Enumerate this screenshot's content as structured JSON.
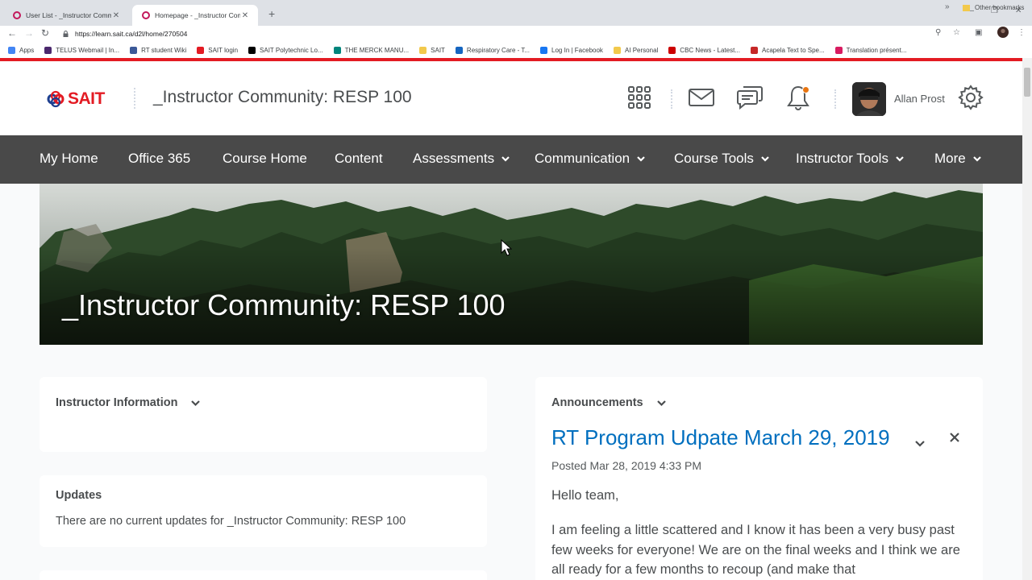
{
  "browser": {
    "tabs": [
      {
        "title": "User List - _Instructor Community",
        "active": false
      },
      {
        "title": "Homepage - _Instructor Community",
        "active": true
      }
    ],
    "url": "https://learn.sait.ca/d2l/home/270504",
    "bookmarks": [
      {
        "label": "Apps",
        "color": "#4285f4"
      },
      {
        "label": "TELUS Webmail | In...",
        "color": "#4b286d"
      },
      {
        "label": "RT student Wiki",
        "color": "#3b5998"
      },
      {
        "label": "SAIT login",
        "color": "#e31b23"
      },
      {
        "label": "SAIT Polytechnic Lo...",
        "color": "#000000"
      },
      {
        "label": "THE MERCK MANU...",
        "color": "#00857c"
      },
      {
        "label": "SAIT",
        "color": "#f2c94c"
      },
      {
        "label": "Respiratory Care - T...",
        "color": "#1565c0"
      },
      {
        "label": "Log In | Facebook",
        "color": "#1877f2"
      },
      {
        "label": "AI Personal",
        "color": "#f2c94c"
      },
      {
        "label": "CBC News - Latest...",
        "color": "#cc0000"
      },
      {
        "label": "Acapela Text to Spe...",
        "color": "#c62828"
      },
      {
        "label": "Translation présent...",
        "color": "#d81b60"
      }
    ],
    "other_bookmarks": "Other bookmarks"
  },
  "header": {
    "logo_text": "SAIT",
    "course_title": "_Instructor Community: RESP 100",
    "user_name": "Allan Prost",
    "icons": [
      "apps-grid-icon",
      "mail-icon",
      "chat-icon",
      "bell-icon",
      "gear-icon"
    ],
    "notification_color": "#e87511"
  },
  "nav": {
    "items": [
      {
        "label": "My Home",
        "dropdown": false
      },
      {
        "label": "Office 365",
        "dropdown": false
      },
      {
        "label": "Course Home",
        "dropdown": false
      },
      {
        "label": "Content",
        "dropdown": false
      },
      {
        "label": "Assessments",
        "dropdown": true
      },
      {
        "label": "Communication",
        "dropdown": true
      },
      {
        "label": "Course Tools",
        "dropdown": true
      },
      {
        "label": "Instructor Tools",
        "dropdown": true
      },
      {
        "label": "More",
        "dropdown": true
      }
    ]
  },
  "banner": {
    "title": "_Instructor Community: RESP 100"
  },
  "widgets": {
    "instructor_info": {
      "title": "Instructor Information"
    },
    "updates": {
      "title": "Updates",
      "text": "There are no current updates for _Instructor Community: RESP 100"
    },
    "announcements": {
      "title": "Announcements",
      "headline": "RT Program Udpate March 29, 2019",
      "posted": "Posted Mar 28, 2019 4:33 PM",
      "greeting": "Hello team,",
      "body": "I am feeling a little scattered and I know it has been a very busy past few weeks for everyone!  We are on the final weeks and I think we are all ready for a few months to recoup (and make that"
    }
  },
  "colors": {
    "brand_red": "#e31b23",
    "nav_bg": "#494949",
    "link_blue": "#006fbf"
  }
}
